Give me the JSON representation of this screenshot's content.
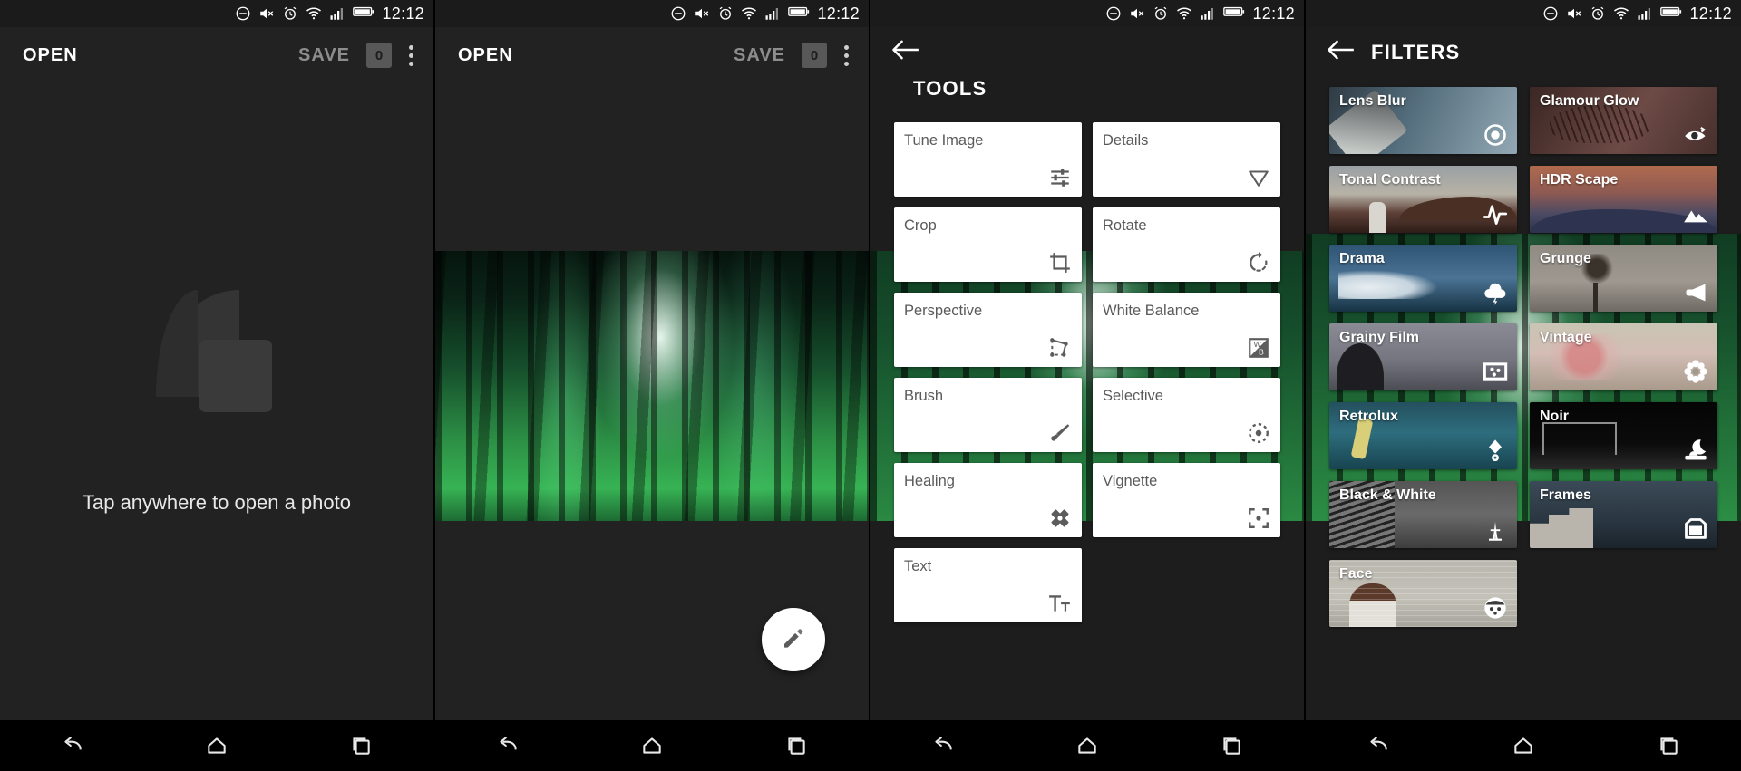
{
  "statusbar": {
    "time": "12:12",
    "icons": [
      "do-not-disturb-icon",
      "volume-mute-icon",
      "alarm-icon",
      "wifi-icon",
      "cellular-signal-icon",
      "battery-icon"
    ]
  },
  "screens": [
    {
      "id": "empty-state",
      "appbar": {
        "open_label": "OPEN",
        "save_label": "SAVE",
        "badge": "0",
        "menu": "overflow-menu-icon"
      },
      "empty": {
        "logo": "snapseed-logo-icon",
        "message": "Tap anywhere to open a photo"
      }
    },
    {
      "id": "photo-loaded",
      "appbar": {
        "open_label": "OPEN",
        "save_label": "SAVE",
        "badge": "0",
        "menu": "overflow-menu-icon"
      },
      "fab": {
        "icon": "pencil-edit-icon"
      }
    },
    {
      "id": "tools",
      "title": "TOOLS",
      "back": "back-arrow-icon",
      "tools": [
        {
          "label": "Tune Image",
          "icon": "sliders-icon"
        },
        {
          "label": "Details",
          "icon": "triangle-down-icon"
        },
        {
          "label": "Crop",
          "icon": "crop-icon"
        },
        {
          "label": "Rotate",
          "icon": "rotate-icon"
        },
        {
          "label": "Perspective",
          "icon": "perspective-icon"
        },
        {
          "label": "White Balance",
          "icon": "white-balance-icon"
        },
        {
          "label": "Brush",
          "icon": "brush-icon"
        },
        {
          "label": "Selective",
          "icon": "selective-target-icon"
        },
        {
          "label": "Healing",
          "icon": "healing-bandage-icon"
        },
        {
          "label": "Vignette",
          "icon": "vignette-icon"
        },
        {
          "label": "Text",
          "icon": "text-icon"
        }
      ]
    },
    {
      "id": "filters",
      "title": "FILTERS",
      "back": "back-arrow-icon",
      "filters": [
        {
          "label": "Lens Blur",
          "icon": "lens-blur-icon",
          "thumb": "th-lensblur"
        },
        {
          "label": "Glamour Glow",
          "icon": "eye-icon",
          "thumb": "th-glamour"
        },
        {
          "label": "Tonal Contrast",
          "icon": "waveform-icon",
          "thumb": "th-tonal"
        },
        {
          "label": "HDR Scape",
          "icon": "mountains-icon",
          "thumb": "th-hdr"
        },
        {
          "label": "Drama",
          "icon": "storm-cloud-icon",
          "thumb": "th-drama"
        },
        {
          "label": "Grunge",
          "icon": "megaphone-icon",
          "thumb": "th-grunge"
        },
        {
          "label": "Grainy Film",
          "icon": "film-grain-icon",
          "thumb": "th-grainy"
        },
        {
          "label": "Vintage",
          "icon": "flower-icon",
          "thumb": "th-vintage"
        },
        {
          "label": "Retrolux",
          "icon": "retro-lamp-icon",
          "thumb": "th-retrolux"
        },
        {
          "label": "Noir",
          "icon": "moon-night-icon",
          "thumb": "th-noir"
        },
        {
          "label": "Black & White",
          "icon": "eiffel-tower-icon",
          "thumb": "th-bw"
        },
        {
          "label": "Frames",
          "icon": "frame-icon",
          "thumb": "th-frames"
        },
        {
          "label": "Face",
          "icon": "face-icon",
          "thumb": "th-face"
        }
      ]
    }
  ],
  "navbar": {
    "back": "nav-back-icon",
    "home": "nav-home-icon",
    "recents": "nav-recents-icon"
  },
  "colors": {
    "background": "#222222",
    "card": "#ffffff",
    "label": "#5a5a5a",
    "accent": "#ffffff"
  }
}
